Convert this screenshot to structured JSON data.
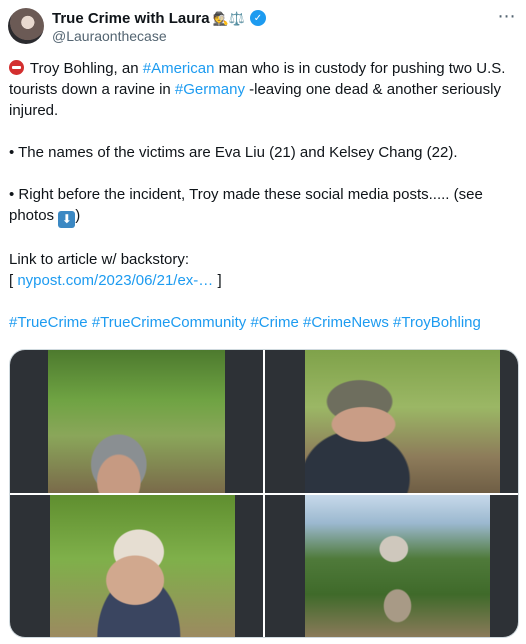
{
  "author": {
    "display_name": "True Crime with Laura",
    "name_emojis": "🕵️⚖️",
    "verified_icon": "verified-badge-icon",
    "handle": "@Lauraonthecase"
  },
  "more_icon": "more-options-icon",
  "tweet": {
    "line1_pre": " Troy Bohling, an ",
    "line1_tag1": "#American",
    "line1_mid": " man who is in custody for pushing two U.S. tourists down a ravine in ",
    "line1_tag2": "#Germany",
    "line1_post": " -leaving one dead & another seriously injured.",
    "bullet1": "• The names of the victims are Eva Liu (21) and Kelsey Chang (22).",
    "bullet2_pre": "• Right before the incident, Troy made these social media posts..... (see photos ",
    "bullet2_post": ")",
    "link_label": "Link to article w/ backstory:",
    "link_open": "[ ",
    "link_url": "nypost.com/2023/06/21/ex-…",
    "link_close": " ]",
    "hashtags": [
      "#TrueCrime",
      "#TrueCrimeCommunity",
      "#Crime",
      "#CrimeNews",
      "#TroyBohling"
    ]
  },
  "media": {
    "photos": [
      {
        "icon": "selfie-trail-photo"
      },
      {
        "icon": "selfie-forest-roots-photo"
      },
      {
        "icon": "selfie-white-cap-photo"
      },
      {
        "icon": "castle-viewpoint-photo"
      }
    ]
  },
  "colors": {
    "link": "#1d9bf0",
    "text": "#0f1419",
    "secondary": "#536471"
  }
}
